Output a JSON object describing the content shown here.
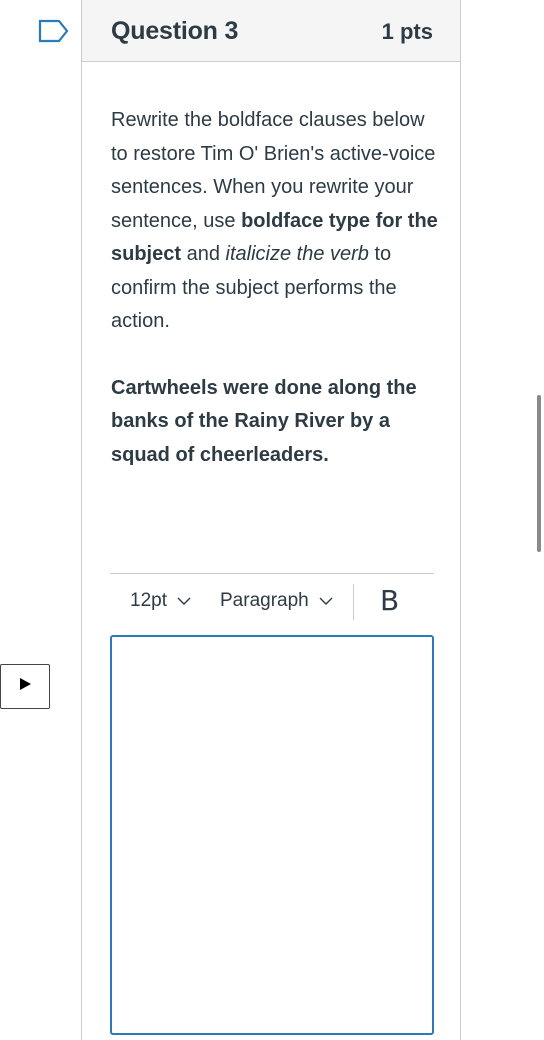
{
  "question": {
    "title": "Question 3",
    "points": "1 pts",
    "prompt": {
      "part1": "Rewrite the boldface clauses below to restore Tim O' Brien's active-voice sentences. When you rewrite your sentence, use ",
      "bold": "boldface type for the subject",
      "part2": " and ",
      "italic": "italicize the verb",
      "part3": " to confirm the subject performs the action."
    },
    "sentence": "Cartwheels were done along the banks of the Rainy River by a squad of cheerleaders."
  },
  "toolbar": {
    "font_size": "12pt",
    "block_format": "Paragraph",
    "bold_label": "B"
  },
  "icons": {
    "flag": "flag-bookmark-icon",
    "chevron": "chevron-down-icon",
    "play": "play-triangle-icon"
  },
  "colors": {
    "text": "#2d3b45",
    "accent": "#2b7abc",
    "border": "#c7cdd1",
    "header_bg": "#f5f5f5"
  }
}
